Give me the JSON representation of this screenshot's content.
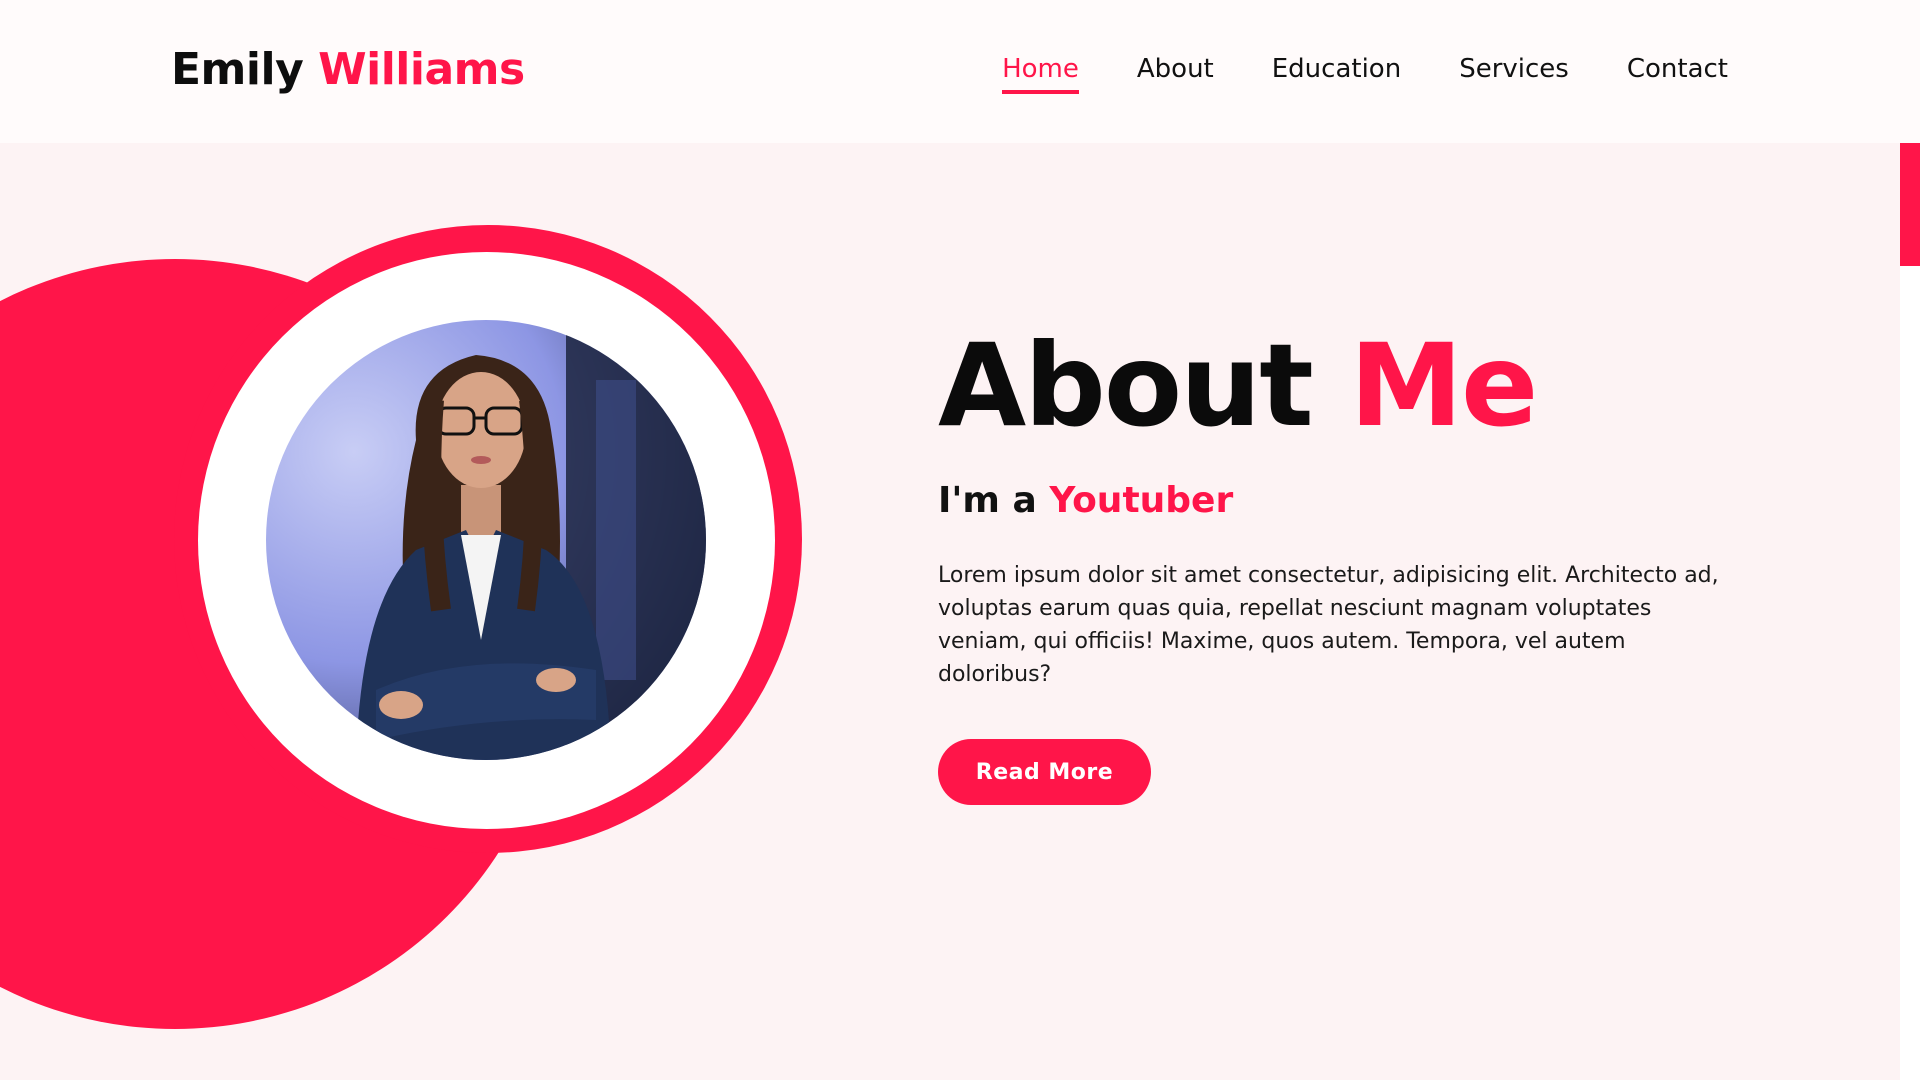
{
  "brand": {
    "first": "Emily",
    "last": "Williams"
  },
  "nav": {
    "items": [
      {
        "label": "Home",
        "active": true
      },
      {
        "label": "About"
      },
      {
        "label": "Education"
      },
      {
        "label": "Services"
      },
      {
        "label": "Contact"
      }
    ]
  },
  "about": {
    "title_part1": "About",
    "title_part2": "Me",
    "subtitle_prefix": "I'm a",
    "subtitle_role": "Youtuber",
    "description": "Lorem ipsum dolor sit amet consectetur, adipisicing elit. Architecto ad, voluptas earum quas quia, repellat nesciunt magnam voluptates veniam, qui officiis! Maxime, quos autem. Tempora, vel autem doloribus?",
    "button_label": "Read More"
  },
  "colors": {
    "accent": "#ff1549",
    "background": "#fdf3f4",
    "text": "#111111"
  },
  "icons": {
    "profile_photo": "portrait-photo"
  }
}
